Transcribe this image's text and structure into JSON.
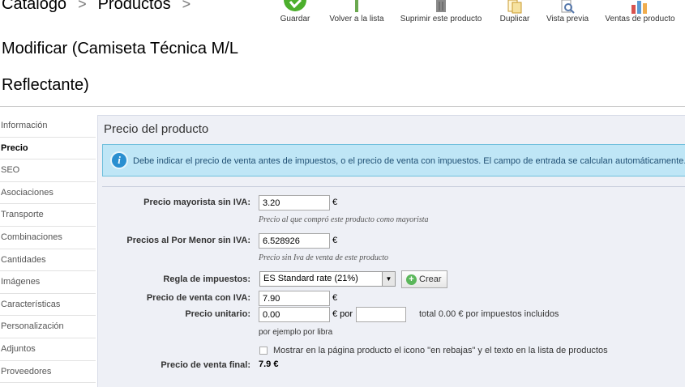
{
  "breadcrumb": {
    "catalog": "Catalogo",
    "products": "Productos",
    "separator": ">"
  },
  "title": "Modificar (Camiseta Técnica M/L Reflectante)",
  "toolbar": [
    {
      "label": "Guardar",
      "icon": "save-icon",
      "color": "#4caf2c"
    },
    {
      "label": "Volver a la lista",
      "icon": "back-icon",
      "color": "#6aa84f"
    },
    {
      "label": "Suprimir este producto",
      "icon": "trash-icon",
      "color": "#888888"
    },
    {
      "label": "Duplicar",
      "icon": "duplicate-icon",
      "color": "#e8b84a"
    },
    {
      "label": "Vista previa",
      "icon": "preview-icon",
      "color": "#6a8fc5"
    },
    {
      "label": "Ventas de producto",
      "icon": "sales-chart-icon",
      "color": "#d9534f"
    }
  ],
  "sidebar": {
    "items": [
      {
        "label": "Información",
        "active": false
      },
      {
        "label": "Precio",
        "active": true
      },
      {
        "label": "SEO",
        "active": false
      },
      {
        "label": "Asociaciones",
        "active": false
      },
      {
        "label": "Transporte",
        "active": false
      },
      {
        "label": "Combinaciones",
        "active": false
      },
      {
        "label": "Cantidades",
        "active": false
      },
      {
        "label": "Imágenes",
        "active": false
      },
      {
        "label": "Características",
        "active": false
      },
      {
        "label": "Personalización",
        "active": false
      },
      {
        "label": "Adjuntos",
        "active": false
      },
      {
        "label": "Proveedores",
        "active": false
      }
    ]
  },
  "panel": {
    "title": "Precio del producto",
    "info": "Debe indicar el precio de venta antes de impuestos, o el precio de venta con impuestos. El campo de entrada se calculan automáticamente.",
    "wholesale": {
      "label": "Precio mayorista sin IVA:",
      "value": "3.20",
      "unit": "€",
      "hint": "Precio al que compró este producto como mayorista"
    },
    "retail": {
      "label": "Precios al Por Menor sin IVA:",
      "value": "6.528926",
      "unit": "€",
      "hint": "Precio sin Iva de venta de este producto"
    },
    "tax_rule": {
      "label": "Regla de impuestos:",
      "selected": "ES Standard rate (21%)",
      "create_label": "Crear"
    },
    "price_with_tax": {
      "label": "Precio de venta con IVA:",
      "value": "7.90",
      "unit": "€"
    },
    "unit_price": {
      "label": "Precio unitario:",
      "value": "0.00",
      "unit_per": "€ por",
      "per_value": "",
      "total": "total 0.00 € por impuestos incluidos",
      "hint": "por ejemplo por libra"
    },
    "on_sale": {
      "label": "Mostrar en la página producto el icono \"en rebajas\" y el texto en la lista de productos",
      "checked": false
    },
    "final_price": {
      "label": "Precio de venta final:",
      "value": "7.9 €"
    }
  }
}
